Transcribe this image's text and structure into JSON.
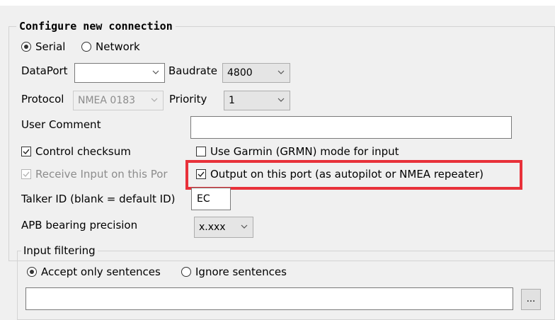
{
  "group": {
    "title": "Configure new connection"
  },
  "conn_type": {
    "serial_label": "Serial",
    "network_label": "Network",
    "selected": "Serial"
  },
  "dataport": {
    "label": "DataPort",
    "value": ""
  },
  "baudrate": {
    "label": "Baudrate",
    "value": "4800"
  },
  "protocol": {
    "label": "Protocol",
    "value": "NMEA 0183"
  },
  "priority": {
    "label": "Priority",
    "value": "1"
  },
  "user_comment": {
    "label": "User Comment",
    "value": ""
  },
  "control_checksum": {
    "label": "Control checksum",
    "checked": true
  },
  "garmin_mode": {
    "label": "Use Garmin (GRMN) mode for input",
    "checked": false
  },
  "receive_input": {
    "label": "Receive Input on this Por",
    "checked": true,
    "enabled": false
  },
  "output_port": {
    "label": "Output on this port (as autopilot or NMEA repeater)",
    "checked": true
  },
  "talker_id": {
    "label": "Talker ID (blank = default ID)",
    "value": "EC"
  },
  "apb_precision": {
    "label": "APB bearing precision",
    "value": "x.xxx"
  },
  "input_filtering": {
    "title": "Input filtering",
    "accept_label": "Accept only sentences",
    "ignore_label": "Ignore sentences",
    "selected": "accept",
    "sentences_value": "",
    "browse_label": "..."
  },
  "colors": {
    "highlight": "#e8313a",
    "background": "#f0f0f0"
  }
}
